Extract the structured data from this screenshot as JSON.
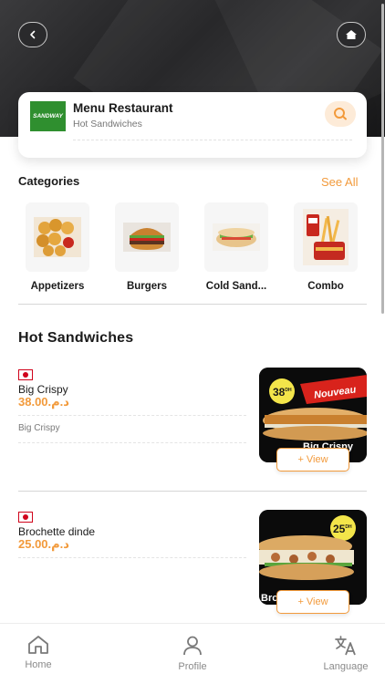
{
  "header": {
    "restaurant_name": "Menu Restaurant",
    "restaurant_subtitle": "Hot Sandwiches",
    "logo_text": "SANDWAY"
  },
  "categories": {
    "title": "Categories",
    "see_all": "See All",
    "items": [
      {
        "label": "Appetizers"
      },
      {
        "label": "Burgers"
      },
      {
        "label": "Cold Sand..."
      },
      {
        "label": "Combo"
      }
    ]
  },
  "section": {
    "title": "Hot Sandwiches"
  },
  "products": [
    {
      "name": "Big Crispy",
      "price": "38.00.د.م",
      "description": "Big Crispy",
      "view_label": "+ View",
      "image_price_badge": "38",
      "image_price_unit": "DH",
      "image_promo": "Nouveau",
      "image_caption": "Big Crispy"
    },
    {
      "name": "Brochette dinde",
      "price": "25.00.د.م",
      "view_label": "+ View",
      "image_price_badge": "25",
      "image_price_unit": "DH",
      "image_caption": "Bro"
    }
  ],
  "tabbar": {
    "items": [
      {
        "label": "Home",
        "icon": "home-icon"
      },
      {
        "label": "Profile",
        "icon": "profile-icon"
      },
      {
        "label": "Language",
        "icon": "language-icon"
      }
    ]
  },
  "colors": {
    "accent": "#f29a3b",
    "hero_dark": "#1d1d1f",
    "logo_green": "#2f8f2f",
    "flag_red": "#d0021b"
  }
}
